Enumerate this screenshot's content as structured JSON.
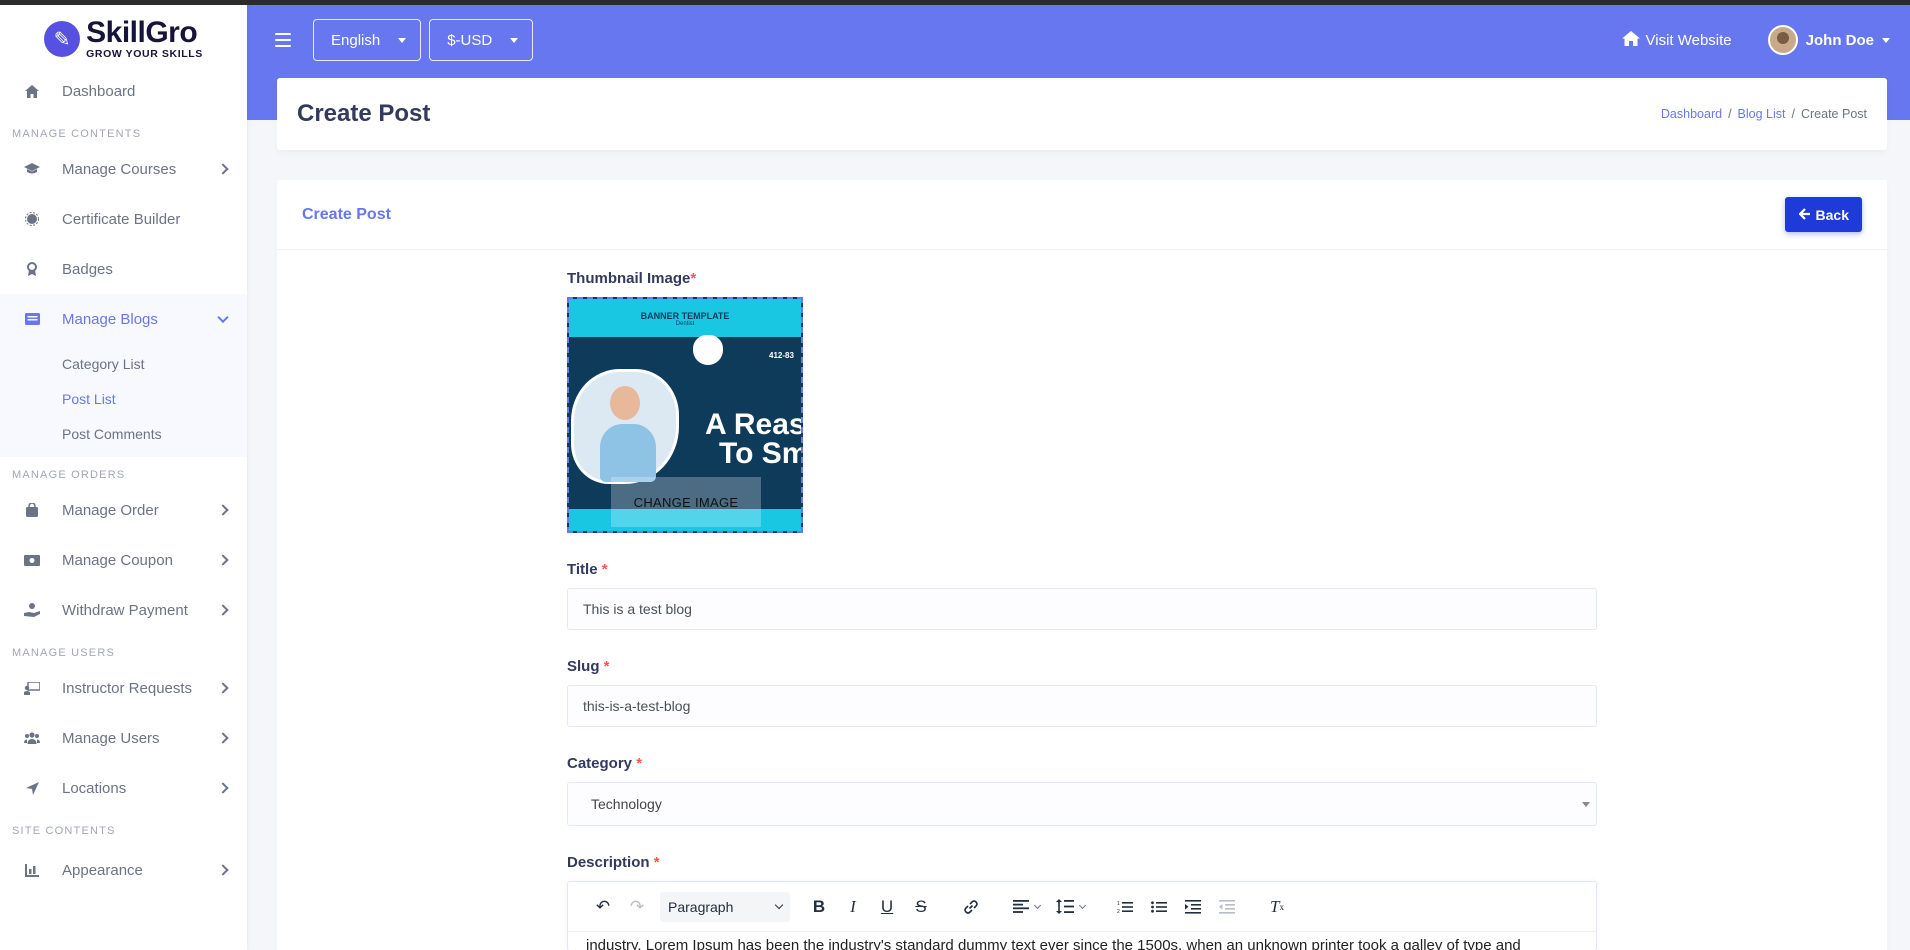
{
  "brand": {
    "name": "SkillGro",
    "tagline": "GROW YOUR SKILLS"
  },
  "sidebar": {
    "dashboard": "Dashboard",
    "sections": {
      "contents": "MANAGE CONTENTS",
      "orders": "MANAGE ORDERS",
      "users": "MANAGE USERS",
      "site": "SITE CONTENTS"
    },
    "items": {
      "courses": "Manage Courses",
      "certificate": "Certificate Builder",
      "badges": "Badges",
      "blogs": "Manage Blogs",
      "order": "Manage Order",
      "coupon": "Manage Coupon",
      "withdraw": "Withdraw Payment",
      "instructor": "Instructor Requests",
      "users": "Manage Users",
      "locations": "Locations",
      "appearance": "Appearance"
    },
    "blog_sub": {
      "category": "Category List",
      "post_list": "Post List",
      "comments": "Post Comments"
    }
  },
  "navbar": {
    "language": "English",
    "currency": "$-USD",
    "visit": "Visit Website",
    "user": "John Doe"
  },
  "page": {
    "title": "Create Post",
    "breadcrumb": {
      "home": "Dashboard",
      "list": "Blog List",
      "current": "Create Post"
    }
  },
  "card": {
    "title": "Create Post",
    "back": "Back"
  },
  "form": {
    "thumbnail_label": "Thumbnail Image",
    "thumbnail": {
      "banner_title": "BANNER TEMPLATE",
      "banner_sub": "Dentist",
      "big_text_1": "A Reaso",
      "big_text_2": "To Smi",
      "phone": "412-83",
      "change_label": "CHANGE IMAGE"
    },
    "title_label": "Title",
    "title_value": "This is a test blog",
    "slug_label": "Slug",
    "slug_value": "this-is-a-test-blog",
    "category_label": "Category",
    "category_value": "Technology",
    "description_label": "Description",
    "required_mark": "*",
    "editor": {
      "block_format": "Paragraph",
      "body_preview": "industry. Lorem Ipsum has been the industry's standard dummy text ever since the 1500s, when an unknown printer took a galley of type and"
    }
  },
  "colors": {
    "primary": "#6777ef",
    "back_button": "#1e3ad8",
    "required": "#fc544b"
  }
}
